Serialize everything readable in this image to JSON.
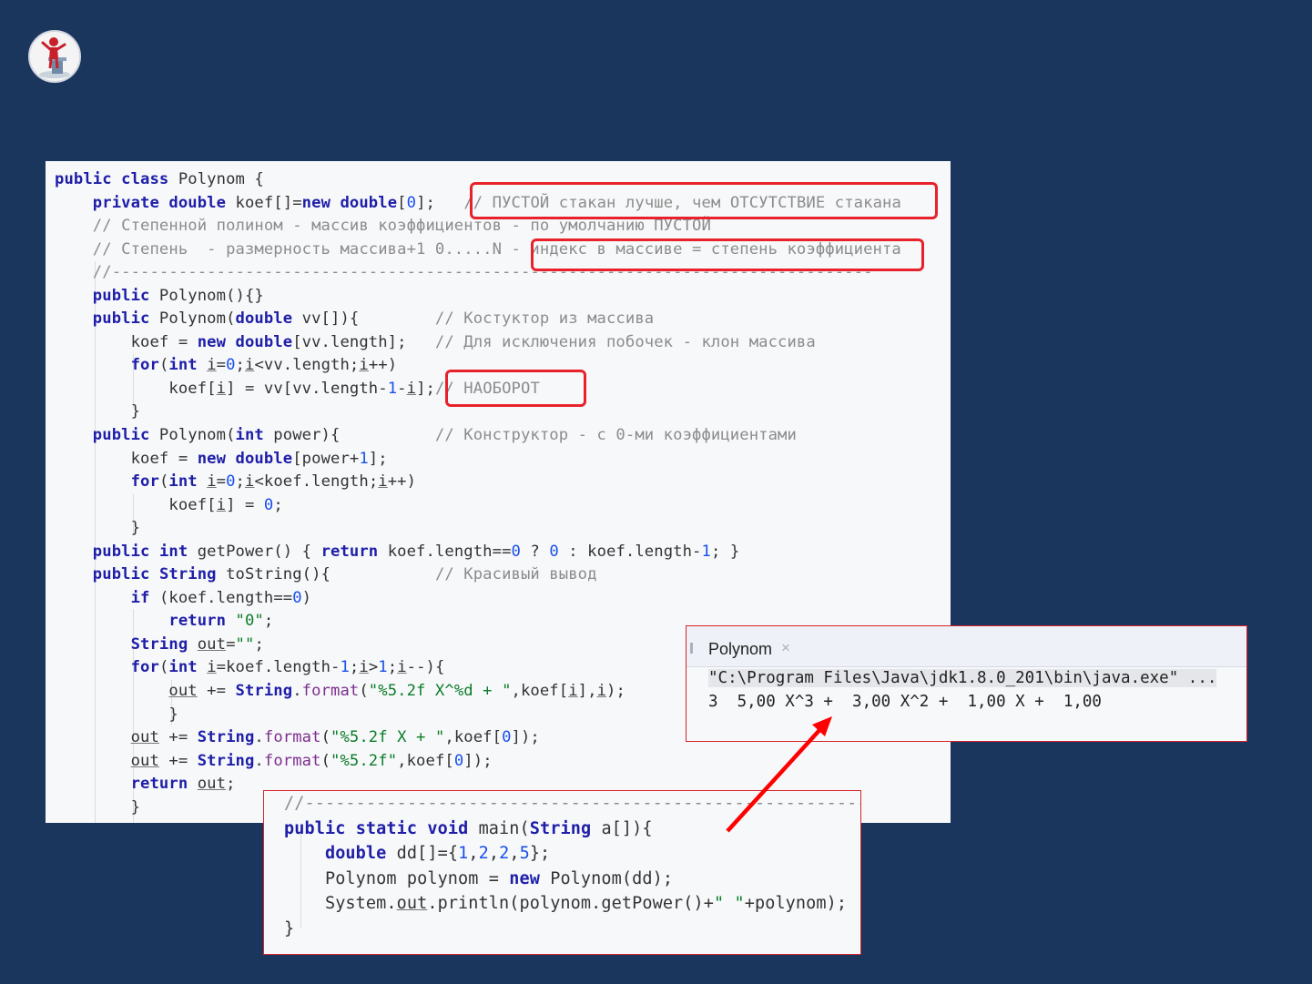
{
  "logo": {
    "icon": "presenter-figure-icon"
  },
  "editor": {
    "lines": [
      "public class Polynom {",
      "    private double koef[]=new double[0];   // ПУСТОЙ стакан лучше, чем ОТСУТСТВИЕ стакана",
      "    // Степенной полином - массив коэффициентов - по умолчанию ПУСТОЙ",
      "    // Степень  - размерность массива+1 0.....N - индекс в массиве = степень коэффициента",
      "    //--------------------------------------------------------------------------------",
      "    public Polynom(){}",
      "    public Polynom(double vv[]){        // Костуктор из массива",
      "        koef = new double[vv.length];   // Для исключения побочек - клон массива",
      "        for(int i=0;i<vv.length;i++)",
      "            koef[i] = vv[vv.length-1-i];// НАОБОРОТ",
      "        }",
      "    public Polynom(int power){          // Конструктор - с 0-ми коэффициентами",
      "        koef = new double[power+1];",
      "        for(int i=0;i<koef.length;i++)",
      "            koef[i] = 0;",
      "        }",
      "    public int getPower() { return koef.length==0 ? 0 : koef.length-1; }",
      "    public String toString(){           // Красивый вывод",
      "        if (koef.length==0)",
      "            return \"0\";",
      "        String out=\"\";",
      "        for(int i=koef.length-1;i>1;i--){",
      "            out += String.format(\"%5.2f X^%d + \",koef[i],i);",
      "            }",
      "        out += String.format(\"%5.2f X + \",koef[0]);",
      "        out += String.format(\"%5.2f\",koef[0]);",
      "        return out;",
      "        }"
    ]
  },
  "console": {
    "tab_label": "Polynom",
    "tab_close": "×",
    "command": "\"C:\\Program Files\\Java\\jdk1.8.0_201\\bin\\java.exe\" ...",
    "output": "3  5,00 X^3 +  3,00 X^2 +  1,00 X +  1,00"
  },
  "main_snippet": {
    "lines": [
      "//-------------------------------------------------------------------",
      "public static void main(String a[]){",
      "    double dd[]={1,2,2,5};",
      "    Polynom polynom = new Polynom(dd);",
      "    System.out.println(polynom.getPower()+\" \"+polynom);",
      "}"
    ]
  },
  "colors": {
    "background": "#1b365d",
    "highlight_box": "#e8222b",
    "arrow": "#ff0000"
  }
}
